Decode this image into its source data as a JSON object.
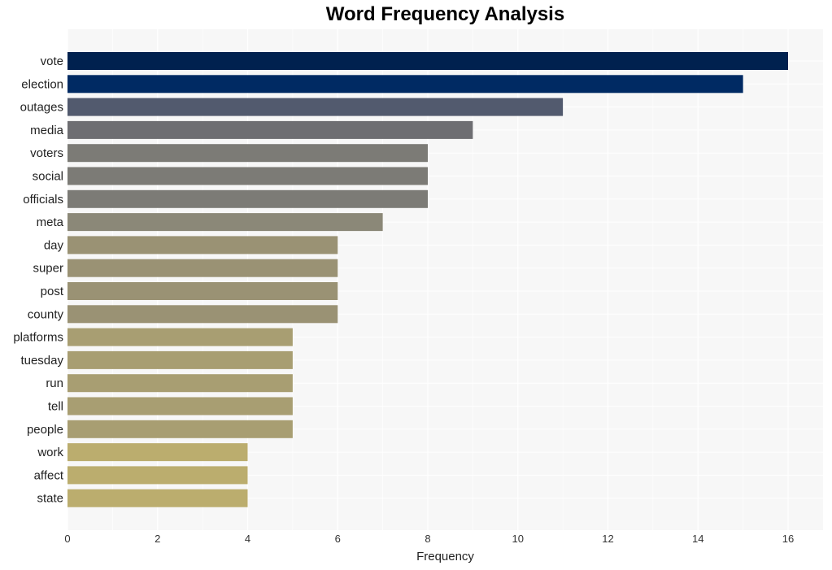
{
  "chart_data": {
    "type": "bar",
    "orientation": "horizontal",
    "title": "Word Frequency Analysis",
    "xlabel": "Frequency",
    "ylabel": "",
    "xlim": [
      0,
      16.8
    ],
    "xticks": [
      0,
      2,
      4,
      6,
      8,
      10,
      12,
      14,
      16
    ],
    "grid": true,
    "categories": [
      "vote",
      "election",
      "outages",
      "media",
      "voters",
      "social",
      "officials",
      "meta",
      "day",
      "super",
      "post",
      "county",
      "platforms",
      "tuesday",
      "run",
      "tell",
      "people",
      "work",
      "affect",
      "state"
    ],
    "values": [
      16,
      15,
      11,
      9,
      8,
      8,
      8,
      7,
      6,
      6,
      6,
      6,
      5,
      5,
      5,
      5,
      5,
      4,
      4,
      4
    ],
    "colors": [
      "#00214f",
      "#002a63",
      "#525a6e",
      "#6e6e72",
      "#7c7b76",
      "#7c7b76",
      "#7c7b76",
      "#8b8878",
      "#9a9274",
      "#9a9274",
      "#9a9274",
      "#9a9274",
      "#a89e72",
      "#a89e72",
      "#a89e72",
      "#a89e72",
      "#a89e72",
      "#bbad6e",
      "#bbad6e",
      "#bbad6e"
    ],
    "plot_background": "#f7f7f7",
    "grid_color": "#ffffff"
  }
}
